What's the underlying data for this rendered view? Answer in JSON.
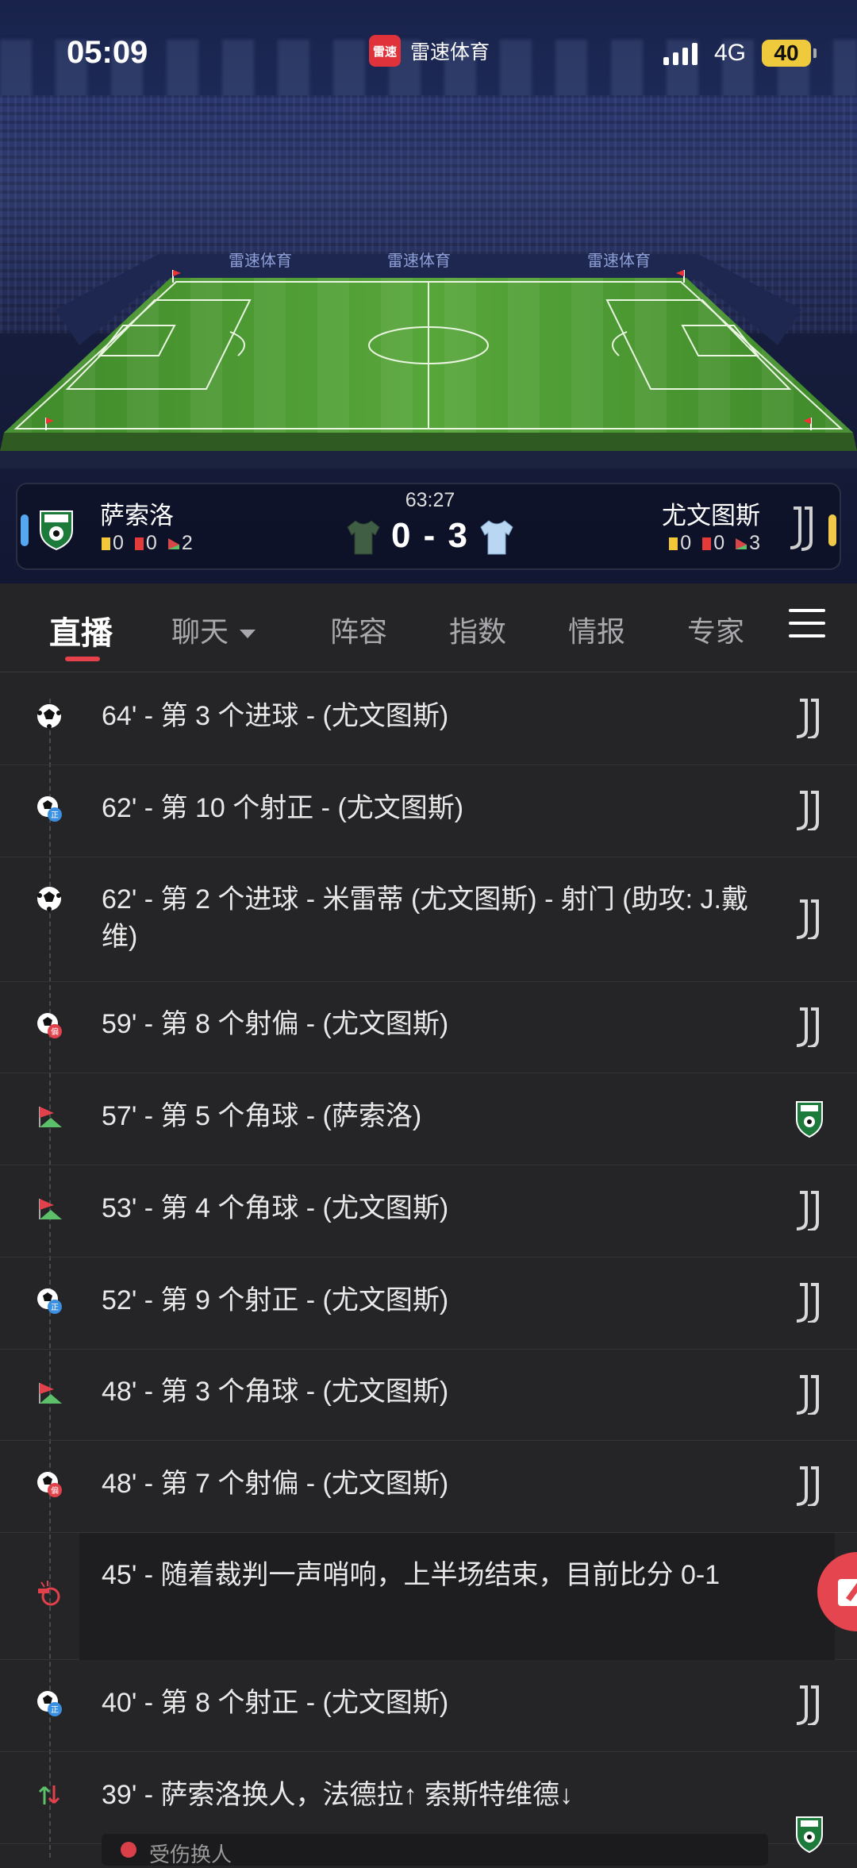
{
  "status_bar": {
    "time": "05:09",
    "app_logo_text": "雷速",
    "app_name": "雷速体育",
    "network": "4G",
    "battery": "40"
  },
  "pitch": {
    "sponsor": "雷速体育"
  },
  "match": {
    "minute": "63:27",
    "score": "0 - 3",
    "home": {
      "name": "萨索洛",
      "yellow": "0",
      "red": "0",
      "corners": "2",
      "accent": "#55a7f0"
    },
    "away": {
      "name": "尤文图斯",
      "yellow": "0",
      "red": "0",
      "corners": "3",
      "accent": "#f0c84a"
    }
  },
  "tabs": [
    {
      "label": "直播",
      "active": true
    },
    {
      "label": "聊天",
      "active": false
    },
    {
      "label": "阵容",
      "active": false
    },
    {
      "label": "指数",
      "active": false
    },
    {
      "label": "情报",
      "active": false
    },
    {
      "label": "专家",
      "active": false
    }
  ],
  "events": [
    {
      "text": "64' - 第 3 个进球 - (尤文图斯)",
      "icon": "goal-icon",
      "team": "juventus"
    },
    {
      "text": "62' - 第 10 个射正 - (尤文图斯)",
      "icon": "shot-on-target-icon",
      "team": "juventus"
    },
    {
      "text": "62' - 第 2 个进球 - 米雷蒂 (尤文图斯) - 射门 (助攻: J.戴维)",
      "icon": "goal-icon",
      "team": "juventus"
    },
    {
      "text": "59' - 第 8 个射偏 - (尤文图斯)",
      "icon": "shot-off-target-icon",
      "team": "juventus"
    },
    {
      "text": "57' - 第 5 个角球 - (萨索洛)",
      "icon": "corner-flag-icon",
      "team": "sassuolo"
    },
    {
      "text": "53' - 第 4 个角球 - (尤文图斯)",
      "icon": "corner-flag-icon",
      "team": "juventus"
    },
    {
      "text": "52' - 第 9 个射正 - (尤文图斯)",
      "icon": "shot-on-target-icon",
      "team": "juventus"
    },
    {
      "text": "48' - 第 3 个角球 - (尤文图斯)",
      "icon": "corner-flag-icon",
      "team": "juventus"
    },
    {
      "text": "48' - 第 7 个射偏 - (尤文图斯)",
      "icon": "shot-off-target-icon",
      "team": "juventus"
    },
    {
      "text": "45' - 随着裁判一声哨响，上半场结束，目前比分 0-1",
      "icon": "whistle-icon",
      "team": ""
    },
    {
      "text": "40' - 第 8 个射正 - (尤文图斯)",
      "icon": "shot-on-target-icon",
      "team": "juventus"
    },
    {
      "text": "39' - 萨索洛换人，法德拉↑ 索斯特维德↓",
      "icon": "substitution-icon",
      "team": "sassuolo"
    }
  ],
  "sub_note": "受伤换人",
  "icon_glyphs": {
    "on_target": "正",
    "off_target": "偏"
  }
}
